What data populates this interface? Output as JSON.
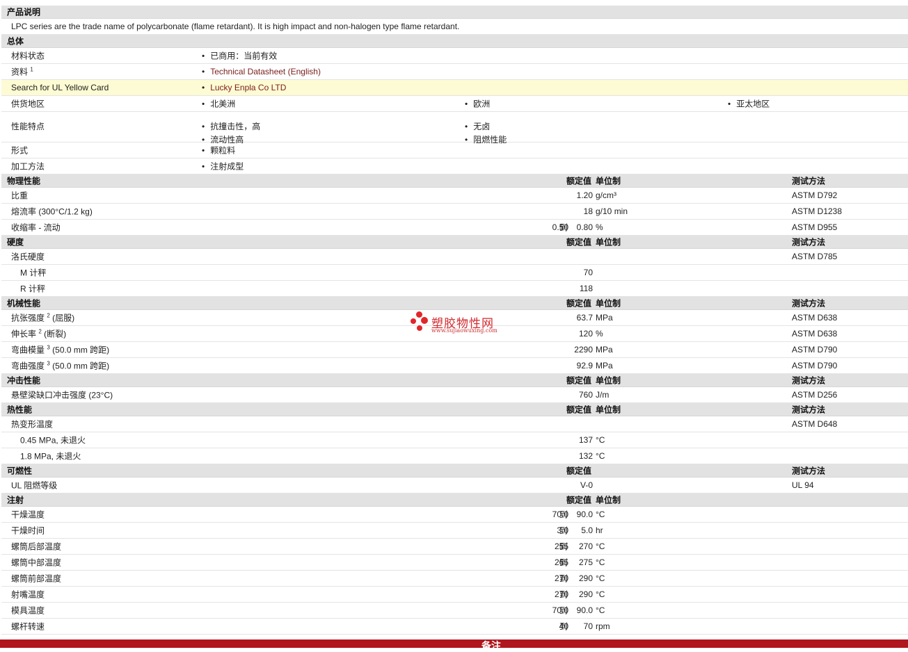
{
  "desc": {
    "title": "产品说明",
    "text": "LPC series are the trade name of polycarbonate (flame retardant). It is high impact and non-halogen type flame retardant."
  },
  "general": {
    "title": "总体",
    "status_label": "材料状态",
    "status_value": "已商用：当前有效",
    "docs_label": "资料",
    "docs_sup": "1",
    "docs_link": "Technical Datasheet (English)",
    "ul_label": "Search for UL Yellow Card",
    "ul_link": "Lucky Enpla Co LTD",
    "supply_label": "供货地区",
    "supply": [
      "北美洲",
      "欧洲",
      "亚太地区"
    ],
    "features_label": "性能特点",
    "features": [
      "抗撞击性，高",
      "无卤",
      "流动性高",
      "阻燃性能"
    ],
    "form_label": "形式",
    "form": "颗粒料",
    "process_label": "加工方法",
    "process": "注射成型"
  },
  "cols": {
    "nominal": "额定值",
    "unit": "单位制",
    "method": "测试方法"
  },
  "physical": {
    "title": "物理性能",
    "rows": [
      {
        "name": "比重",
        "value": "1.20",
        "unit": "g/cm³",
        "method": "ASTM D792"
      },
      {
        "name": "熔流率  (300°C/1.2 kg)",
        "value": "18",
        "unit": "g/10 min",
        "method": "ASTM D1238"
      },
      {
        "name": "收缩率  - 流动",
        "low": "0.50",
        "to": "到",
        "high": "0.80",
        "unit": "%",
        "method": "ASTM D955"
      }
    ]
  },
  "hardness": {
    "title": "硬度",
    "name": "洛氏硬度",
    "method": "ASTM D785",
    "rows": [
      {
        "name": "M 计秤",
        "value": "70"
      },
      {
        "name": "R 计秤",
        "value": "118"
      }
    ]
  },
  "mechanical": {
    "title": "机械性能",
    "rows": [
      {
        "name": "抗张强度",
        "sup": "2",
        "cond": "(屈服)",
        "value": "63.7",
        "unit": "MPa",
        "method": "ASTM D638"
      },
      {
        "name": "伸长率",
        "sup": "2",
        "cond": "(断裂)",
        "value": "120",
        "unit": "%",
        "method": "ASTM D638"
      },
      {
        "name": "弯曲模量",
        "sup": "3",
        "cond": "(50.0 mm 跨距)",
        "value": "2290",
        "unit": "MPa",
        "method": "ASTM D790"
      },
      {
        "name": "弯曲强度",
        "sup": "3",
        "cond": "(50.0 mm 跨距)",
        "value": "92.9",
        "unit": "MPa",
        "method": "ASTM D790"
      }
    ]
  },
  "impact": {
    "title": "冲击性能",
    "name": "悬壁梁缺口冲击强度  (23°C)",
    "value": "760",
    "unit": "J/m",
    "method": "ASTM D256"
  },
  "thermal": {
    "title": "热性能",
    "name": "热变形温度",
    "method": "ASTM D648",
    "rows": [
      {
        "name": "0.45 MPa, 未退火",
        "value": "137",
        "unit": "°C"
      },
      {
        "name": "1.8 MPa, 未退火",
        "value": "132",
        "unit": "°C"
      }
    ]
  },
  "flammability": {
    "title": "可燃性",
    "name": "UL 阻燃等级",
    "value": "V-0",
    "method": "UL 94"
  },
  "injection": {
    "title": "注射",
    "rows": [
      {
        "name": "干燥温度",
        "low": "70.0",
        "high": "90.0",
        "unit": "°C"
      },
      {
        "name": "干燥时间",
        "low": "3.0",
        "high": "5.0",
        "unit": "hr"
      },
      {
        "name": "螺筒后部温度",
        "low": "255",
        "high": "270",
        "unit": "°C"
      },
      {
        "name": "螺筒中部温度",
        "low": "265",
        "high": "275",
        "unit": "°C"
      },
      {
        "name": "螺筒前部温度",
        "low": "270",
        "high": "290",
        "unit": "°C"
      },
      {
        "name": "射嘴温度",
        "low": "270",
        "high": "290",
        "unit": "°C"
      },
      {
        "name": "模具温度",
        "low": "70.0",
        "high": "90.0",
        "unit": "°C"
      },
      {
        "name": "螺杆转速",
        "low": "40",
        "high": "70",
        "unit": "rpm"
      }
    ],
    "to": "到"
  },
  "footer": {
    "label": "备注"
  },
  "logo": {
    "cn": "塑胶物性网",
    "url": "www.sujiaowuxing.com"
  },
  "colors": {
    "header_bg": "#e2e2e2",
    "link": "#7b1c1c",
    "highlight": "#fdfbd3",
    "footer": "#b0161e"
  }
}
